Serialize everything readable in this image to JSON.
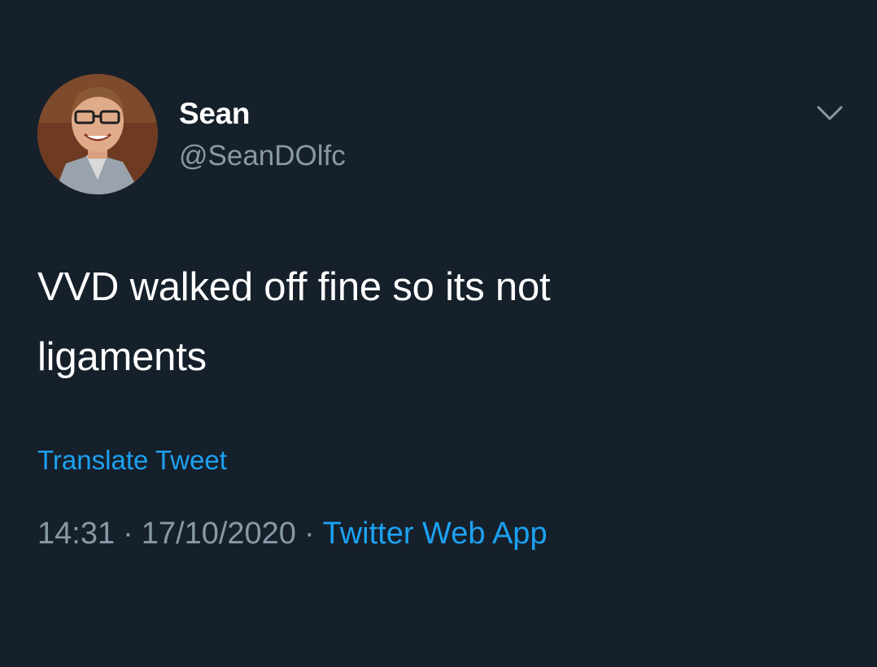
{
  "tweet": {
    "author": {
      "display_name": "Sean",
      "handle": "@SeanDOlfc"
    },
    "text_line1": "VVD walked off fine so its not",
    "text_line2": "ligaments",
    "translate_label": "Translate Tweet",
    "time": "14:31",
    "separator": "·",
    "date": "17/10/2020",
    "source": "Twitter Web App"
  },
  "icons": {
    "avatar": "profile-photo",
    "menu": "chevron-down-icon"
  },
  "colors": {
    "background": "#15202b",
    "primary_text": "#ffffff",
    "secondary_text": "#8899a6",
    "link": "#1da1f2"
  }
}
